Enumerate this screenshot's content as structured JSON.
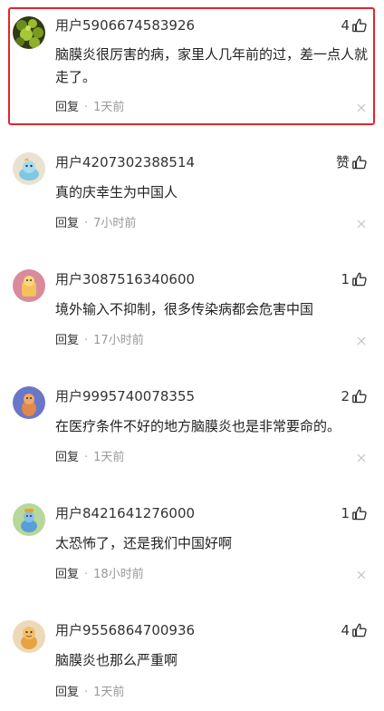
{
  "comments": [
    {
      "username": "用户5906674583926",
      "likes": "4",
      "content": "脑膜炎很厉害的病，家里人几年前的过，差一点人就走了。",
      "reply_label": "回复",
      "separator": "·",
      "time": "1天前",
      "avatar_icon": "green-cluster-avatar",
      "highlighted": true
    },
    {
      "username": "用户4207302388514",
      "likes": "赞",
      "content": "真的庆幸生为中国人",
      "reply_label": "回复",
      "separator": "·",
      "time": "7小时前",
      "avatar_icon": "cartoon-avatar-blue"
    },
    {
      "username": "用户3087516340600",
      "likes": "1",
      "content": "境外输入不抑制，很多传染病都会危害中国",
      "reply_label": "回复",
      "separator": "·",
      "time": "17小时前",
      "avatar_icon": "cartoon-avatar-pink"
    },
    {
      "username": "用户9995740078355",
      "likes": "2",
      "content": "在医疗条件不好的地方脑膜炎也是非常要命的。",
      "reply_label": "回复",
      "separator": "·",
      "time": "1天前",
      "avatar_icon": "cartoon-avatar-purple"
    },
    {
      "username": "用户8421641276000",
      "likes": "1",
      "content": "太恐怖了，还是我们中国好啊",
      "reply_label": "回复",
      "separator": "·",
      "time": "18小时前",
      "avatar_icon": "cartoon-avatar-green"
    },
    {
      "username": "用户9556864700936",
      "likes": "4",
      "content": "脑膜炎也那么严重啊",
      "reply_label": "回复",
      "separator": "·",
      "time": "1天前",
      "avatar_icon": "cartoon-avatar-orange"
    }
  ],
  "colors": {
    "highlight_border": "#e0262b",
    "text_primary": "#222222",
    "text_secondary": "#999999"
  }
}
